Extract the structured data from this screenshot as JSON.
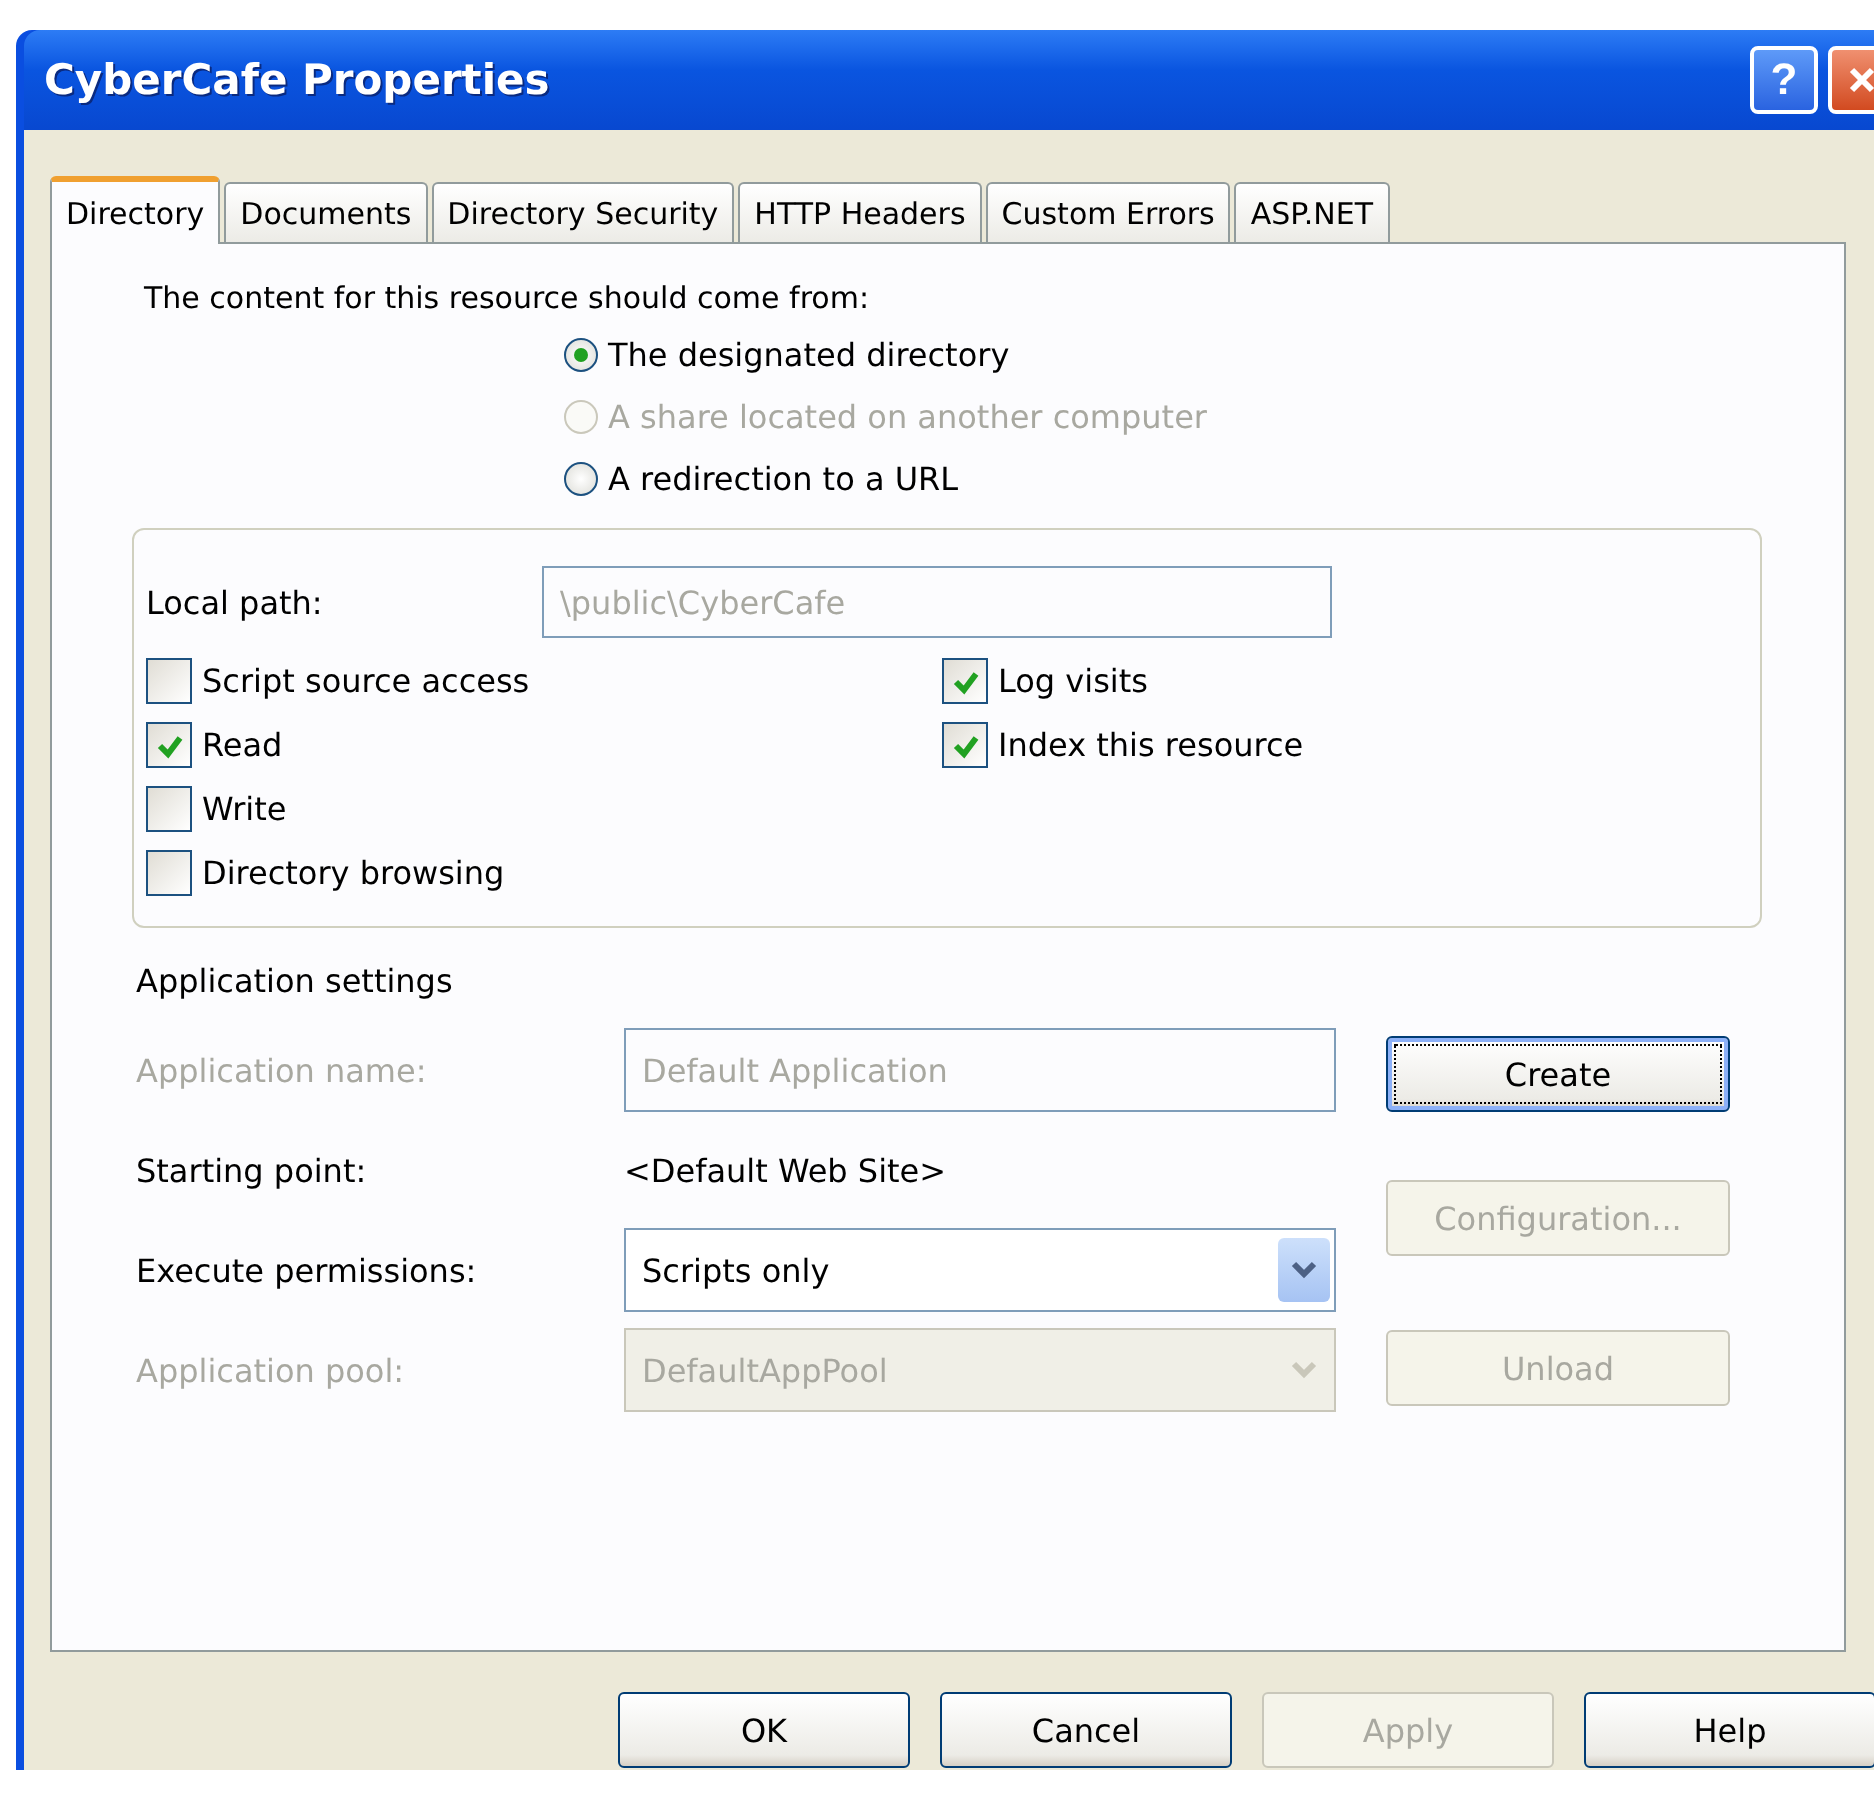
{
  "window": {
    "title": "CyberCafe Properties"
  },
  "title_buttons": [
    {
      "kind": "help",
      "label": "?"
    },
    {
      "kind": "close"
    }
  ],
  "tabs": [
    {
      "label": "Directory",
      "selected": true
    },
    {
      "label": "Documents",
      "selected": false
    },
    {
      "label": "Directory Security",
      "selected": false
    },
    {
      "label": "HTTP Headers",
      "selected": false
    },
    {
      "label": "Custom Errors",
      "selected": false
    },
    {
      "label": "ASP.NET",
      "selected": false
    }
  ],
  "content_source": {
    "prompt": "The content for this resource should come from:",
    "options": [
      {
        "label": "The designated directory",
        "selected": true,
        "disabled": false
      },
      {
        "label": "A share located on another computer",
        "selected": false,
        "disabled": true
      },
      {
        "label": "A redirection to a URL",
        "selected": false,
        "disabled": false
      }
    ]
  },
  "local_path": {
    "label": "Local path:",
    "value": "\\public\\CyberCafe",
    "disabled": true
  },
  "checkboxes_left": [
    {
      "label": "Script source access",
      "checked": false
    },
    {
      "label": "Read",
      "checked": true
    },
    {
      "label": "Write",
      "checked": false
    },
    {
      "label": "Directory browsing",
      "checked": false
    }
  ],
  "checkboxes_right": [
    {
      "label": "Log visits",
      "checked": true
    },
    {
      "label": "Index this resource",
      "checked": true
    }
  ],
  "application_settings": {
    "heading": "Application settings",
    "rows": [
      {
        "kind": "field",
        "label": "Application name:",
        "value": "Default Application",
        "disabled": true
      },
      {
        "kind": "text",
        "label": "Starting point:",
        "value": "<Default Web Site>",
        "disabled": false
      },
      {
        "kind": "select",
        "label": "Execute permissions:",
        "value": "Scripts only",
        "disabled": false
      },
      {
        "kind": "select",
        "label": "Application pool:",
        "value": "DefaultAppPool",
        "disabled": true
      }
    ],
    "buttons": [
      {
        "label": "Create",
        "disabled": false,
        "focused": true
      },
      {
        "label": "Configuration...",
        "disabled": true,
        "focused": false
      },
      {
        "label": "Unload",
        "disabled": true,
        "focused": false
      }
    ]
  },
  "footer_buttons": [
    {
      "label": "OK",
      "disabled": false
    },
    {
      "label": "Cancel",
      "disabled": false
    },
    {
      "label": "Apply",
      "disabled": true
    },
    {
      "label": "Help",
      "disabled": false
    }
  ]
}
